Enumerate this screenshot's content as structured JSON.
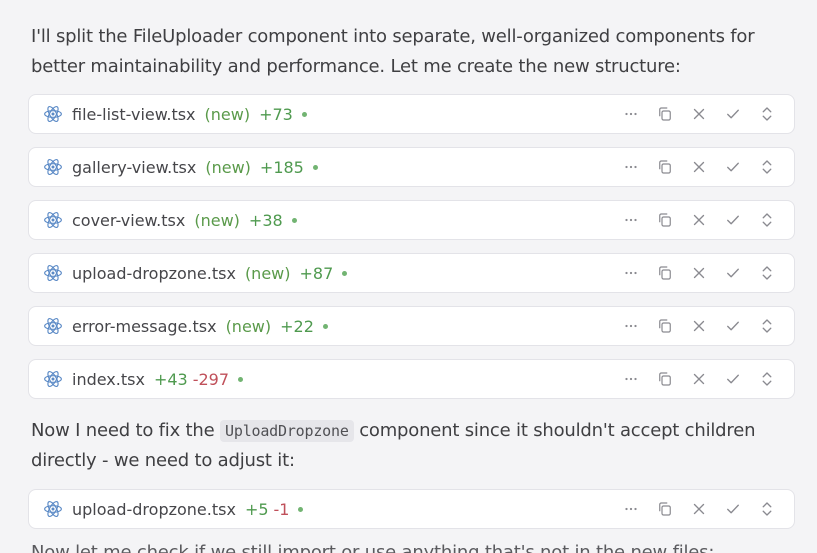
{
  "messages": {
    "intro": "I'll split the FileUploader component into separate, well-organized components for better maintainability and performance. Let me create the new structure:",
    "fix_before": "Now I need to fix the ",
    "fix_code": "UploadDropzone",
    "fix_after": " component since it shouldn't accept children directly - we need to adjust it:",
    "trailing": "Now let me check if we still import or use anything that's not in the new files:"
  },
  "files": [
    {
      "name": "file-list-view.tsx",
      "tag": "(new)",
      "added": "+73",
      "removed": ""
    },
    {
      "name": "gallery-view.tsx",
      "tag": "(new)",
      "added": "+185",
      "removed": ""
    },
    {
      "name": "cover-view.tsx",
      "tag": "(new)",
      "added": "+38",
      "removed": ""
    },
    {
      "name": "upload-dropzone.tsx",
      "tag": "(new)",
      "added": "+87",
      "removed": ""
    },
    {
      "name": "error-message.tsx",
      "tag": "(new)",
      "added": "+22",
      "removed": ""
    },
    {
      "name": "index.tsx",
      "tag": "",
      "added": "+43",
      "removed": "-297"
    },
    {
      "name": "upload-dropzone.tsx",
      "tag": "",
      "added": "+5",
      "removed": "-1"
    }
  ],
  "actions": {
    "more": "more-icon",
    "copy": "copy-icon",
    "reject": "close-icon",
    "accept": "check-icon",
    "expand": "expand-icon"
  },
  "colors": {
    "react_icon": "#5b8ac6",
    "added": "#4f9a4f",
    "removed": "#c0505a",
    "new_tag": "#5a9a4a",
    "icon_gray": "#8a8a90"
  }
}
